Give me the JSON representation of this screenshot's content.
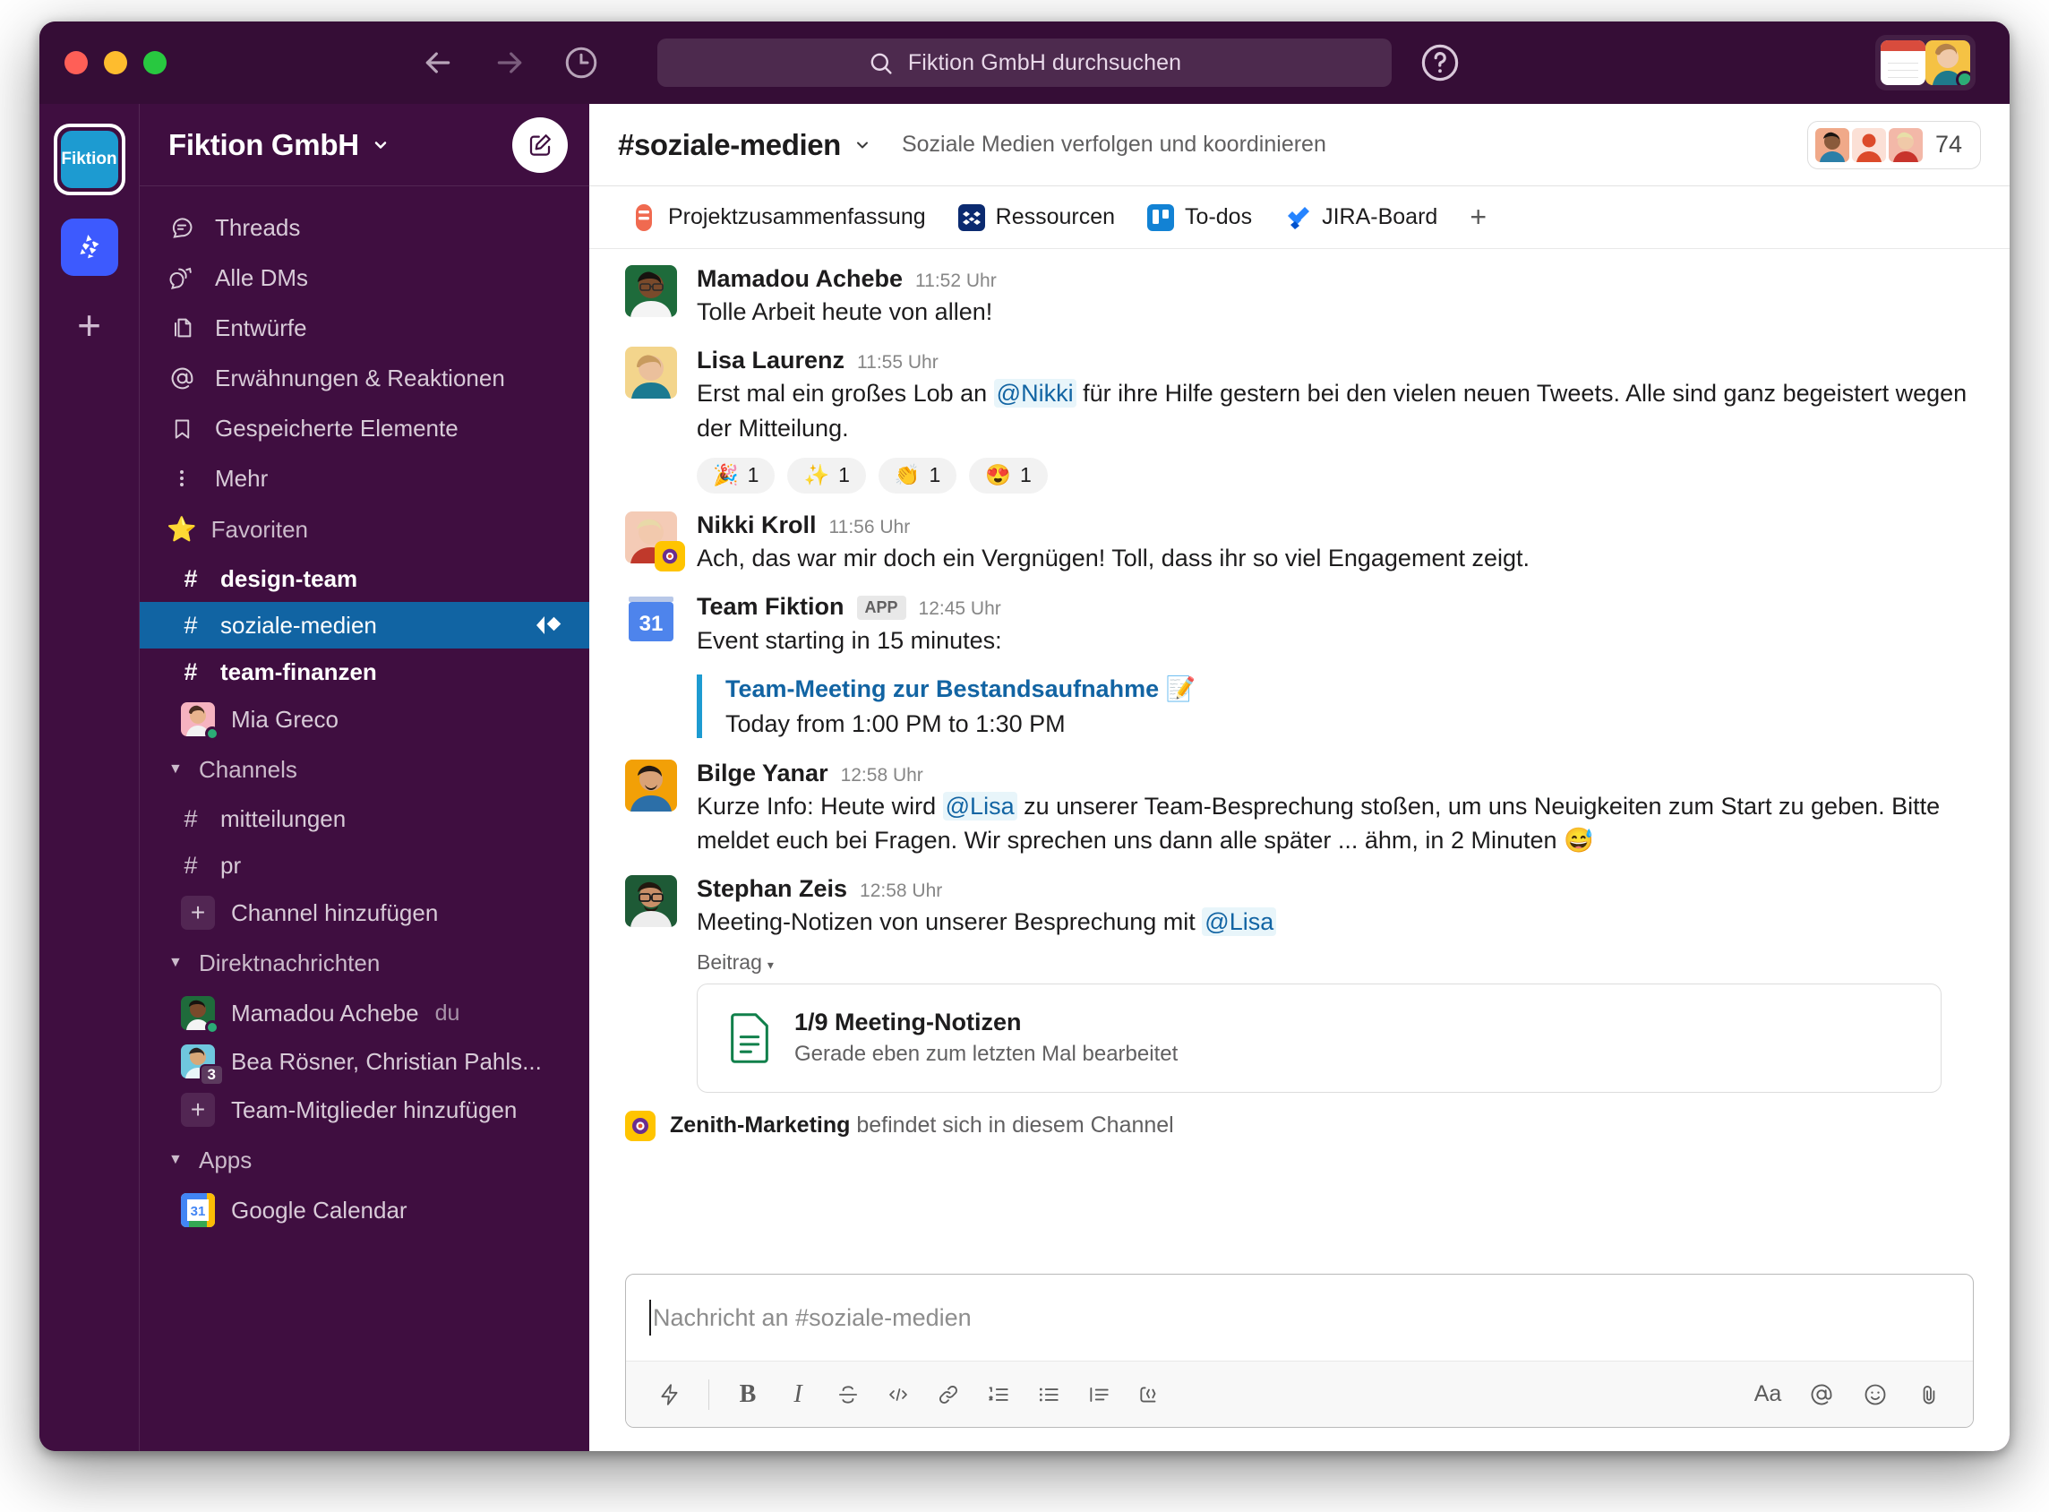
{
  "titlebar": {
    "back_icon": "arrow-left-icon",
    "forward_icon": "arrow-right-icon",
    "history_icon": "clock-icon",
    "search_placeholder": "Fiktion GmbH durchsuchen",
    "help_icon": "help-circle-icon"
  },
  "rail": {
    "workspace_tile_label": "Fiktion",
    "second_app_icon": "croissant-app-icon",
    "add_label": "+"
  },
  "sidebar": {
    "workspace_name": "Fiktion GmbH",
    "compose_icon": "compose-pencil-icon",
    "nav": [
      {
        "label": "Threads",
        "icon": "threads-icon"
      },
      {
        "label": "Alle DMs",
        "icon": "dm-icon"
      },
      {
        "label": "Entwürfe",
        "icon": "drafts-icon"
      },
      {
        "label": "Erwähnungen & Reaktionen",
        "icon": "at-icon"
      },
      {
        "label": "Gespeicherte Elemente",
        "icon": "bookmark-icon"
      },
      {
        "label": "Mehr",
        "icon": "more-dots-icon"
      }
    ],
    "favorites": {
      "title": "Favoriten",
      "icon": "star-icon",
      "items": [
        {
          "label": "design-team",
          "type": "channel",
          "state": "unread"
        },
        {
          "label": "soziale-medien",
          "type": "channel",
          "state": "active"
        },
        {
          "label": "team-finanzen",
          "type": "channel",
          "state": "unread"
        },
        {
          "label": "Mia Greco",
          "type": "dm",
          "presence": "online"
        }
      ]
    },
    "channels": {
      "title": "Channels",
      "items": [
        {
          "label": "mitteilungen",
          "type": "channel"
        },
        {
          "label": "pr",
          "type": "channel"
        },
        {
          "label": "Channel hinzufügen",
          "type": "add"
        }
      ]
    },
    "dms": {
      "title": "Direktnachrichten",
      "items": [
        {
          "label": "Mamadou Achebe",
          "suffix": "du",
          "type": "dm",
          "presence": "online"
        },
        {
          "label": "Bea Rösner, Christian Pahls...",
          "badge": "3",
          "type": "group"
        },
        {
          "label": "Team-Mitglieder hinzufügen",
          "type": "add"
        }
      ]
    },
    "apps": {
      "title": "Apps",
      "items": [
        {
          "label": "Google Calendar",
          "icon": "google-calendar-icon",
          "day": "31"
        }
      ]
    }
  },
  "channel_header": {
    "name": "#soziale-medien",
    "caret": "⌄",
    "topic": "Soziale Medien verfolgen und koordinieren",
    "member_count": "74"
  },
  "tabs": [
    {
      "label": "Projektzusammenfassung",
      "icon": "asana-icon"
    },
    {
      "label": "Ressourcen",
      "icon": "dropbox-icon"
    },
    {
      "label": "To-dos",
      "icon": "trello-icon"
    },
    {
      "label": "JIRA-Board",
      "icon": "jira-icon"
    }
  ],
  "tab_add": "+",
  "messages": [
    {
      "author": "Mamadou Achebe",
      "time": "11:52 Uhr",
      "text": "Tolle Arbeit heute von allen!"
    },
    {
      "author": "Lisa Laurenz",
      "time": "11:55 Uhr",
      "text_pre": "Erst mal ein großes Lob an ",
      "mention": "@Nikki",
      "text_post": " für ihre Hilfe gestern bei den vielen neuen Tweets. Alle sind ganz begeistert wegen der Mitteilung.",
      "reactions": [
        {
          "emoji": "🎉",
          "count": "1"
        },
        {
          "emoji": "✨",
          "count": "1"
        },
        {
          "emoji": "👏",
          "count": "1"
        },
        {
          "emoji": "😍",
          "count": "1"
        }
      ]
    },
    {
      "author": "Nikki Kroll",
      "time": "11:56 Uhr",
      "text": "Ach, das war mir doch ein Vergnügen! Toll, dass ihr so viel Engagement zeigt."
    },
    {
      "author": "Team Fiktion",
      "app_tag": "APP",
      "time": "12:45 Uhr",
      "text": "Event starting in 15 minutes:",
      "quote_title": "Team-Meeting zur Bestandsaufnahme 📝",
      "quote_sub": "Today from 1:00 PM to 1:30 PM"
    },
    {
      "author": "Bilge Yanar",
      "time": "12:58 Uhr",
      "text_pre": "Kurze Info: Heute wird ",
      "mention": "@Lisa",
      "text_post": " zu unserer Team-Besprechung stoßen, um uns Neuigkeiten zum Start zu geben. Bitte meldet euch bei Fragen. Wir sprechen uns dann alle später ... ähm, in 2 Minuten 😅"
    },
    {
      "author": "Stephan Zeis",
      "time": "12:58 Uhr",
      "text_pre": "Meeting-Notizen von unserer Besprechung mit ",
      "mention": "@Lisa",
      "text_post": "",
      "post_label": "Beitrag",
      "file": {
        "title": "1/9 Meeting-Notizen",
        "sub": "Gerade eben zum letzten Mal bearbeitet",
        "icon": "document-icon"
      }
    }
  ],
  "app_note": {
    "app_name": "Zenith-Marketing",
    "text": " befindet sich in diesem Channel",
    "icon": "zenith-app-icon"
  },
  "composer": {
    "placeholder": "Nachricht an #soziale-medien",
    "toolbar": [
      {
        "name": "shortcuts-icon",
        "glyph": "⚡"
      },
      {
        "name": "bold-icon",
        "glyph": "B"
      },
      {
        "name": "italic-icon",
        "glyph": "I"
      },
      {
        "name": "strikethrough-icon",
        "glyph": "S"
      },
      {
        "name": "code-icon",
        "glyph": "</>"
      },
      {
        "name": "link-icon",
        "glyph": "🔗"
      },
      {
        "name": "ordered-list-icon",
        "glyph": "1."
      },
      {
        "name": "bulleted-list-icon",
        "glyph": "•"
      },
      {
        "name": "blockquote-icon",
        "glyph": "❝"
      },
      {
        "name": "code-block-icon",
        "glyph": "{}"
      }
    ],
    "toolbar_right": [
      {
        "name": "formatting-icon",
        "glyph": "Aa"
      },
      {
        "name": "mention-icon",
        "glyph": "@"
      },
      {
        "name": "emoji-icon",
        "glyph": "☺"
      },
      {
        "name": "attachment-icon",
        "glyph": "📎"
      }
    ]
  },
  "colors": {
    "sidebar_bg": "#3F0E40",
    "titlebar_bg": "#350D36",
    "active_channel": "#1164A3",
    "link": "#1264A3",
    "presence_online": "#2BAC76"
  }
}
